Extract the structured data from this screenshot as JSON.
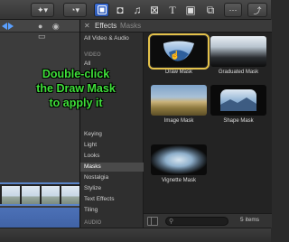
{
  "browser": {
    "title": "Effects",
    "breadcrumb": "Masks",
    "sidebar": [
      {
        "label": "All Video & Audio",
        "type": "item"
      },
      {
        "label": "VIDEO",
        "type": "section"
      },
      {
        "label": "All",
        "type": "item"
      },
      {
        "label": "Keying",
        "type": "item"
      },
      {
        "label": "Light",
        "type": "item"
      },
      {
        "label": "Looks",
        "type": "item"
      },
      {
        "label": "Masks",
        "type": "selected"
      },
      {
        "label": "Nostalgia",
        "type": "item"
      },
      {
        "label": "Stylize",
        "type": "item"
      },
      {
        "label": "Text Effects",
        "type": "item"
      },
      {
        "label": "Tiling",
        "type": "item"
      },
      {
        "label": "AUDIO",
        "type": "section"
      }
    ],
    "tiles": [
      {
        "label": "Draw Mask",
        "selected": true
      },
      {
        "label": "Graduated Mask",
        "selected": false
      },
      {
        "label": "Image Mask",
        "selected": false
      },
      {
        "label": "Shape Mask",
        "selected": false
      },
      {
        "label": "Vignette Mask",
        "selected": false
      }
    ],
    "item_count": "5 items",
    "search_placeholder": ""
  },
  "overlay": {
    "line1": "Double-click",
    "line2": "the Draw Mask",
    "line3": "to apply it"
  },
  "colors": {
    "accent": "#3d6fd6",
    "selection": "#e3c14a",
    "callout": "#3fe03a"
  },
  "icons": [
    "magic-wand-icon",
    "speedometer-icon",
    "effects-browser-icon",
    "photo-icon",
    "music-icon",
    "title-icon",
    "generator-icon",
    "theme-icon",
    "transition-icon",
    "share-icon"
  ]
}
